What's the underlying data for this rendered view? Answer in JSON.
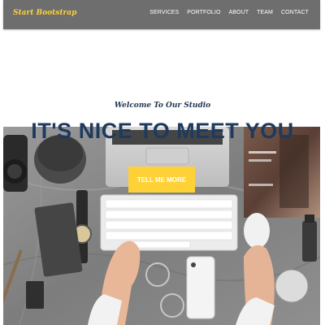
{
  "navbar": {
    "brand": "Start Bootstrap",
    "links": [
      "SERVICES",
      "PORTFOLIO",
      "ABOUT",
      "TEAM",
      "CONTACT"
    ]
  },
  "hero": {
    "subheading": "Welcome To Our Studio",
    "heading": "IT'S NICE TO MEET YOU",
    "button_label": "TELL ME MORE"
  },
  "colors": {
    "navbar_bg": "#6e6e6e",
    "brand": "#fed136",
    "accent": "#fed136",
    "heading": "#1d3a5f"
  }
}
